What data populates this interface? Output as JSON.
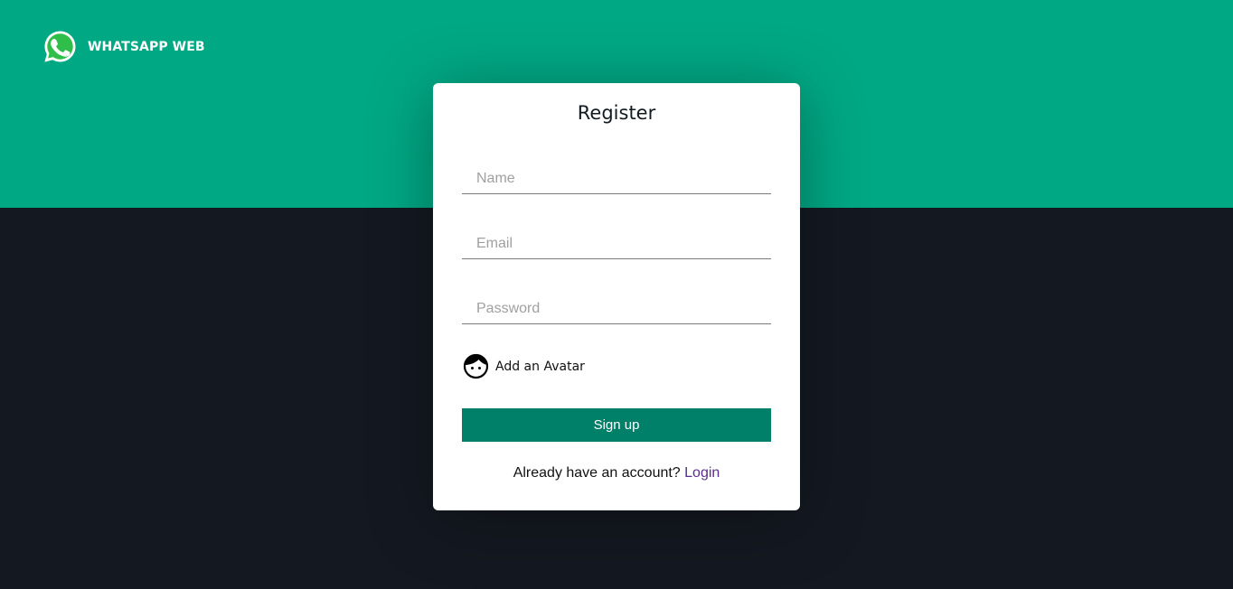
{
  "header": {
    "brand_title": "WHATSAPP WEB",
    "logo_icon": "whatsapp-logo-icon"
  },
  "colors": {
    "accent": "#00a884",
    "dark_bg": "#141921",
    "button": "#008069",
    "link": "#5b2c8f"
  },
  "form": {
    "title": "Register",
    "name_placeholder": "Name",
    "email_placeholder": "Email",
    "password_placeholder": "Password",
    "avatar_label": "Add an Avatar",
    "avatar_icon": "avatar-face-icon",
    "submit_label": "Sign up",
    "footer_text": "Already have an account? ",
    "login_link": "Login"
  }
}
